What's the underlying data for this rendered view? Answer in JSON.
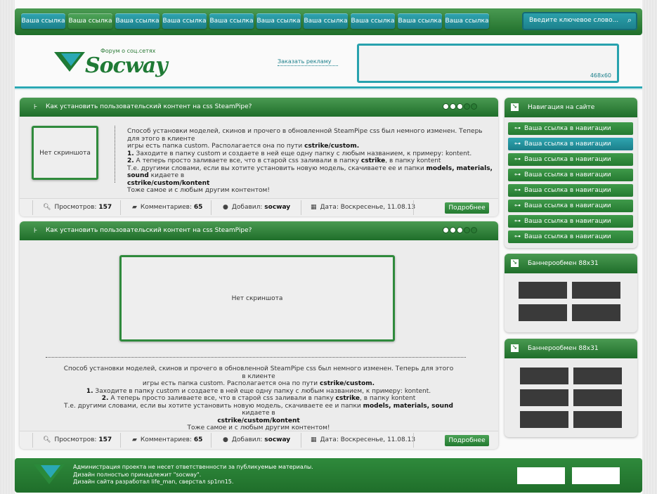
{
  "nav": {
    "links": [
      "Ваша ссылка",
      "Ваша ссылка",
      "Ваша ссылка",
      "Ваша ссылка",
      "Ваша ссылка",
      "Ваша ссылка",
      "Ваша ссылка",
      "Ваша ссылка",
      "Ваша ссылка",
      "Ваша ссылка"
    ],
    "active_index": 1,
    "search_placeholder": "Введите ключевое слово..."
  },
  "header": {
    "logo_tagline": "Форум о соц.сетях",
    "logo_name": "Socway",
    "ad_link": "Заказать рекламу",
    "banner_size": "468x60"
  },
  "posts": [
    {
      "title": "Как установить пользовательский контент на css SteamPipe?",
      "thumb": "Нет скриншота",
      "text": [
        "Способ установки моделей, скинов и прочего в обновленной SteamPipe css был немного изменен. Теперь для этого в клиенте",
        "игры есть папка custom. Располагается она по пути ",
        "cstrike/custom.",
        "1.",
        " Заходите в папку custom и создаете в ней еще одну папку с любым названием, к примеру: kontent.",
        "2.",
        " А теперь просто заливаете все, что в старой css заливали в папку ",
        "cstrike",
        ", в папку kontent",
        "Т.е. другими словами, если вы хотите установить новую модель, скачиваете ее и папки ",
        "models, materials, sound",
        " кидаете в",
        "cstrike/custom/kontent",
        "Тоже самое и с любым другим контентом!"
      ],
      "views_label": "Просмотров:",
      "views": "157",
      "comments_label": "Комментариев:",
      "comments": "65",
      "author_label": "Добавил:",
      "author": "socway",
      "date_label": "Дата: Воскресенье, 11.08.13",
      "more": "Подробнее"
    },
    {
      "title": "Как установить пользовательский контент на css SteamPipe?",
      "thumb": "Нет скриншота",
      "text": [
        "Способ установки моделей, скинов и прочего в обновленной SteamPipe css был немного изменен. Теперь для этого в клиенте",
        "игры есть папка custom. Располагается она по пути ",
        "cstrike/custom.",
        "1.",
        " Заходите в папку custom и создаете в ней еще одну папку с любым названием, к примеру: kontent.",
        "2.",
        " А теперь просто заливаете все, что в старой css заливали в папку ",
        "cstrike",
        ", в папку kontent",
        "Т.е. другими словами, если вы хотите установить новую модель, скачиваете ее и папки ",
        "models, materials, sound",
        " кидаете в",
        "cstrike/custom/kontent",
        "Тоже самое и с любым другим контентом!"
      ],
      "views_label": "Просмотров:",
      "views": "157",
      "comments_label": "Комментариев:",
      "comments": "65",
      "author_label": "Добавил:",
      "author": "socway",
      "date_label": "Дата: Воскресенье, 11.08.13",
      "more": "Подробнее"
    }
  ],
  "sidebar": {
    "nav_title": "Навигация на сайте",
    "nav_items": [
      "Ваша ссылка в навигации",
      "Ваша ссылка в навигации",
      "Ваша ссылка в навигации",
      "Ваша ссылка в навигации",
      "Ваша ссылка в навигации",
      "Ваша ссылка в навигации",
      "Ваша ссылка в навигации",
      "Ваша ссылка в навигации"
    ],
    "nav_highlight_index": 1,
    "banner1_title": "Баннерообмен 88x31",
    "banner2_title": "Баннерообмен 88x31"
  },
  "footer": {
    "line1": "Администрация проекта не несет ответственности за публикуемые материалы.",
    "line2": "Дизайн полностью принадлежит \"socway\".",
    "line3": "Дизайн сайта разработал life_man, сверстал sp1nn15."
  },
  "colors": {
    "green": "#2f8a3c",
    "teal": "#2aa8b4"
  }
}
